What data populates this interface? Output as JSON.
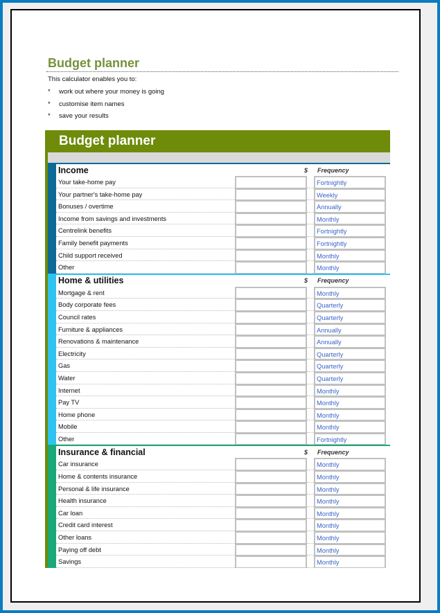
{
  "document": {
    "title": "Budget planner",
    "intro": "This calculator enables you to:",
    "bullet_marker": "*",
    "bullets": [
      "work out where your money is going",
      "customise item names",
      "save your results"
    ]
  },
  "planner": {
    "header": "Budget planner",
    "amount_col_label": "$",
    "frequency_col_label": "Frequency",
    "colors": {
      "header_green": "#6e8b0a",
      "income": "#0e6b96",
      "home": "#2fc3ef",
      "insurance": "#1aa876",
      "frequency_text": "#3a64c8"
    },
    "sections": [
      {
        "title": "Income",
        "rows": [
          {
            "label": "Your take-home pay",
            "amount": "",
            "frequency": "Fortnightly"
          },
          {
            "label": "Your partner's take-home pay",
            "amount": "",
            "frequency": "Weekly"
          },
          {
            "label": "Bonuses / overtime",
            "amount": "",
            "frequency": "Annually"
          },
          {
            "label": "Income from savings and investments",
            "amount": "",
            "frequency": "Monthly"
          },
          {
            "label": "Centrelink benefits",
            "amount": "",
            "frequency": "Fortnightly"
          },
          {
            "label": "Family benefit payments",
            "amount": "",
            "frequency": "Fortnightly"
          },
          {
            "label": "Child support received",
            "amount": "",
            "frequency": "Monthly"
          },
          {
            "label": "Other",
            "amount": "",
            "frequency": "Monthly"
          }
        ]
      },
      {
        "title": "Home & utilities",
        "rows": [
          {
            "label": "Mortgage & rent",
            "amount": "",
            "frequency": "Monthly"
          },
          {
            "label": "Body corporate fees",
            "amount": "",
            "frequency": "Quarterly"
          },
          {
            "label": "Council rates",
            "amount": "",
            "frequency": "Quarterly"
          },
          {
            "label": "Furniture & appliances",
            "amount": "",
            "frequency": "Annually"
          },
          {
            "label": "Renovations & maintenance",
            "amount": "",
            "frequency": "Annually"
          },
          {
            "label": "Electricity",
            "amount": "",
            "frequency": "Quarterly"
          },
          {
            "label": "Gas",
            "amount": "",
            "frequency": "Quarterly"
          },
          {
            "label": "Water",
            "amount": "",
            "frequency": "Quarterly"
          },
          {
            "label": "Internet",
            "amount": "",
            "frequency": "Monthly"
          },
          {
            "label": "Pay TV",
            "amount": "",
            "frequency": "Monthly"
          },
          {
            "label": "Home phone",
            "amount": "",
            "frequency": "Monthly"
          },
          {
            "label": "Mobile",
            "amount": "",
            "frequency": "Monthly"
          },
          {
            "label": "Other",
            "amount": "",
            "frequency": "Fortnightly"
          }
        ]
      },
      {
        "title": "Insurance & financial",
        "rows": [
          {
            "label": "Car insurance",
            "amount": "",
            "frequency": "Monthly"
          },
          {
            "label": "Home & contents insurance",
            "amount": "",
            "frequency": "Monthly"
          },
          {
            "label": "Personal & life insurance",
            "amount": "",
            "frequency": "Monthly"
          },
          {
            "label": "Health insurance",
            "amount": "",
            "frequency": "Monthly"
          },
          {
            "label": "Car loan",
            "amount": "",
            "frequency": "Monthly"
          },
          {
            "label": "Credit card interest",
            "amount": "",
            "frequency": "Monthly"
          },
          {
            "label": "Other loans",
            "amount": "",
            "frequency": "Monthly"
          },
          {
            "label": "Paying off debt",
            "amount": "",
            "frequency": "Monthly"
          },
          {
            "label": "Savings",
            "amount": "",
            "frequency": "Monthly"
          }
        ]
      }
    ]
  }
}
